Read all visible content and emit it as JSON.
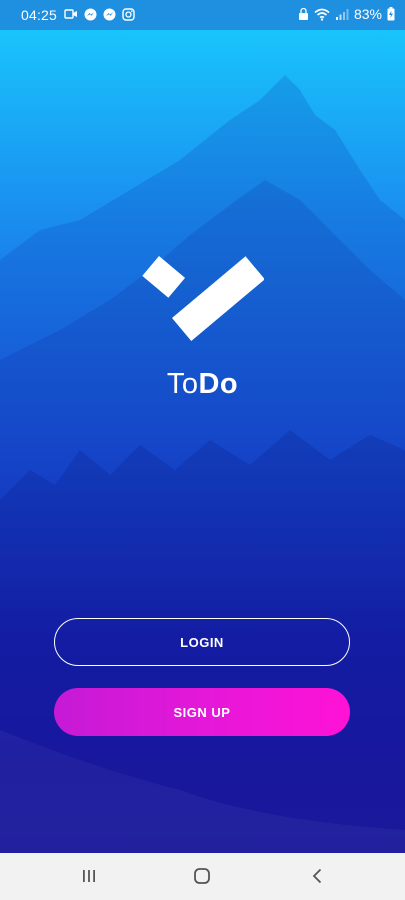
{
  "status_bar": {
    "time": "04:25",
    "battery": "83%",
    "notification_icons": [
      "video-call-icon",
      "messenger-icon",
      "messenger-icon",
      "instagram-icon"
    ],
    "system_icons": [
      "lock-icon",
      "wifi-icon",
      "signal-icon",
      "battery-charging-icon"
    ]
  },
  "app": {
    "name_part1": "To",
    "name_part2": "Do",
    "logo_icon": "checkmark-logo-icon"
  },
  "actions": {
    "login_label": "LOGIN",
    "signup_label": "SIGN UP"
  },
  "nav_bar": {
    "items": [
      "recent-apps-icon",
      "home-icon",
      "back-icon"
    ]
  },
  "colors": {
    "gradient_top": "#19c4fb",
    "gradient_bottom": "#2a13a8",
    "signup_start": "#c51ad6",
    "signup_end": "#ff12d6",
    "status_bar": "#1f8fe0",
    "nav_bar": "#f2f2f2"
  }
}
